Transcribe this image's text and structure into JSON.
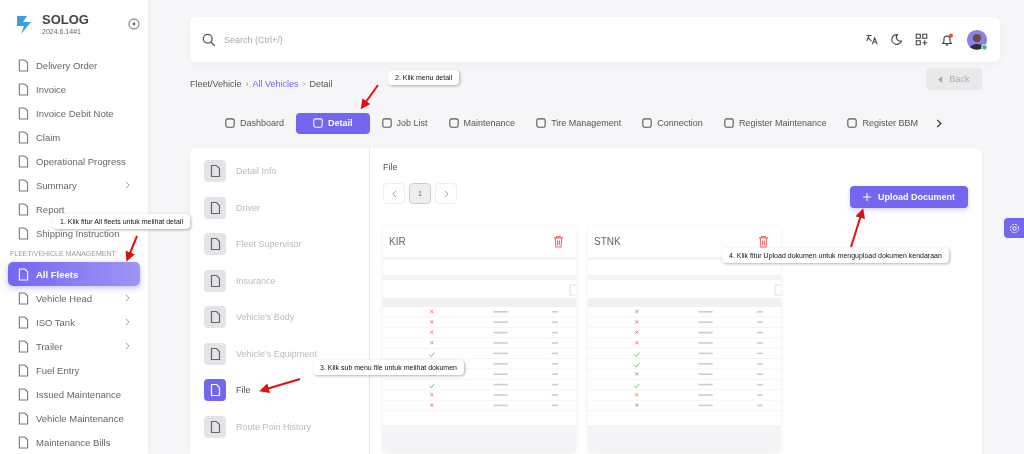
{
  "sidebar": {
    "brand": "SOLOG",
    "version": "2024.6.14#1",
    "items": [
      {
        "label": "Delivery Order",
        "selected": false,
        "expandable": false
      },
      {
        "label": "Invoice",
        "selected": false,
        "expandable": false
      },
      {
        "label": "Invoice Debit Note",
        "selected": false,
        "expandable": false
      },
      {
        "label": "Claim",
        "selected": false,
        "expandable": false
      },
      {
        "label": "Operational Progress",
        "selected": false,
        "expandable": false
      },
      {
        "label": "Summary",
        "selected": false,
        "expandable": true
      },
      {
        "label": "Report",
        "selected": false,
        "expandable": false
      },
      {
        "label": "Shipping Instruction",
        "selected": false,
        "expandable": false
      },
      {
        "kind": "heading",
        "label": "FLEET/VEHICLE MANAGEMENT"
      },
      {
        "label": "All Fleets",
        "selected": true,
        "expandable": false
      },
      {
        "label": "Vehicle Head",
        "selected": false,
        "expandable": true
      },
      {
        "label": "ISO Tank",
        "selected": false,
        "expandable": true
      },
      {
        "label": "Trailer",
        "selected": false,
        "expandable": true
      },
      {
        "label": "Fuel Entry",
        "selected": false,
        "expandable": false
      },
      {
        "label": "Issued Maintenance",
        "selected": false,
        "expandable": false
      },
      {
        "label": "Vehicle Maintenance",
        "selected": false,
        "expandable": false
      },
      {
        "label": "Maintenance Bills",
        "selected": false,
        "expandable": false
      }
    ]
  },
  "search": {
    "placeholder": "Search (Ctrl+/)"
  },
  "breadcrumb": [
    {
      "label": "Fleet/Vehicle",
      "link": false
    },
    {
      "kind": "separator",
      "label": "›"
    },
    {
      "label": "All Vehicles",
      "link": true
    },
    {
      "kind": "separator",
      "label": "›"
    },
    {
      "label": "Detail",
      "link": false
    }
  ],
  "back_button": "Back",
  "tabs": [
    {
      "label": "Dashboard",
      "selected": false
    },
    {
      "label": "Detail",
      "selected": true
    },
    {
      "label": "Job List",
      "selected": false
    },
    {
      "label": "Maintenance",
      "selected": false
    },
    {
      "label": "Tire Management",
      "selected": false
    },
    {
      "label": "Connection",
      "selected": false
    },
    {
      "label": "Register Maintenance",
      "selected": false
    },
    {
      "label": "Register BBM",
      "selected": false
    }
  ],
  "submenu": [
    {
      "label": "Detail Info",
      "selected": false
    },
    {
      "label": "Driver",
      "selected": false
    },
    {
      "label": "Fleet Supervisor",
      "selected": false
    },
    {
      "label": "Insurance",
      "selected": false
    },
    {
      "label": "Vehicle's Body",
      "selected": false
    },
    {
      "label": "Vehicle's Equipment",
      "selected": false
    },
    {
      "label": "File",
      "selected": true
    },
    {
      "label": "Route Poin History",
      "selected": false
    }
  ],
  "file_section": {
    "title": "File",
    "pages": [
      {
        "label": "1",
        "selected": true
      }
    ],
    "upload_button": "Upload Document",
    "documents": [
      {
        "title": "KIR"
      },
      {
        "title": "STNK"
      }
    ]
  },
  "annotations": [
    "1. Klik fitur All fleets untuk melihat detail",
    "2. Klik menu detail",
    "3. Klik sub menu file untuk melihat dokumen",
    "4. Klik fitur Upload dokumen untuk mengupload dokumen kendaraan"
  ]
}
